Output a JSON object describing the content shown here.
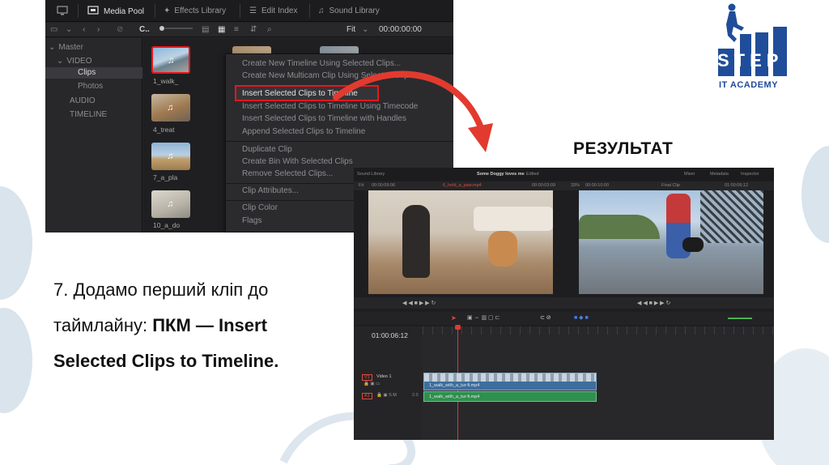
{
  "media_pool": {
    "toolbar": {
      "media_pool_label": "Media Pool",
      "effects_library_label": "Effects Library",
      "edit_index_label": "Edit Index",
      "sound_library_label": "Sound Library"
    },
    "bar2": {
      "bin_short": "C..",
      "zoom_label": "Fit",
      "timecode": "00:00:00:00"
    },
    "sidebar": {
      "items": [
        {
          "label": "Master"
        },
        {
          "label": "VIDEO"
        },
        {
          "label": "Clips"
        },
        {
          "label": "Photos"
        },
        {
          "label": "AUDIO"
        },
        {
          "label": "TIMELINE"
        }
      ]
    },
    "thumbnails": [
      {
        "label": "1_walk_"
      },
      {
        "label": "4_treat"
      },
      {
        "label": "7_a_pla"
      },
      {
        "label": "10_a_do"
      }
    ],
    "context_menu": {
      "items": [
        "Create New Timeline Using Selected Clips...",
        "Create New Multicam Clip Using Selected Clips",
        "Insert Selected Clips to Timeline",
        "Insert Selected Clips to Timeline Using Timecode",
        "Insert Selected Clips to Timeline with Handles",
        "Append Selected Clips to Timeline",
        "Duplicate Clip",
        "Create Bin With Selected Clips",
        "Remove Selected Clips...",
        "Clip Attributes...",
        "Clip Color",
        "Flags"
      ]
    }
  },
  "result_heading": "РЕЗУЛЬТАТ",
  "logo": {
    "line1": "STEP",
    "line2": "IT ACADEMY"
  },
  "instruction": {
    "line1": "7. Додамо перший кліп до",
    "line2_normal": "таймлайну: ",
    "line2_bold": "ПКМ — Insert",
    "line3_bold": "Selected Clips to Timeline."
  },
  "result_screen": {
    "top_left": "Sound Library",
    "project_title": "Some Doggy loves me",
    "project_status": "Edited",
    "mixer_label": "Mixer",
    "metadata_label": "Metadata",
    "inspector_label": "Inspector",
    "source_zoom": "Fit",
    "source_tc_in": "00:00:09:06",
    "source_clip_name": "6_hold_a_paw.mp4",
    "source_tc_out": "00:00:03:09",
    "timeline_zoom": "33%",
    "timeline_tc_in": "00:00:10:00",
    "timeline_name": "Final Clip",
    "timeline_tc_out": "01:00:06:12",
    "timeline_timecode": "01:00:06:12",
    "video_track_label": "V1",
    "video_track_name": "Video 1",
    "audio_track_label": "A1",
    "video_clip_name": "1_walk_with_a_tur-fi.mp4",
    "audio_clip_name": "1_walk_with_a_tur-fi.mp4",
    "audio_track_value": "2.0"
  }
}
